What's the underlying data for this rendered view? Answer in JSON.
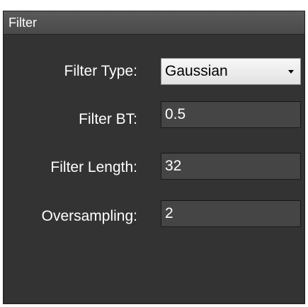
{
  "panel": {
    "title": "Filter"
  },
  "fields": [
    {
      "label": "Filter Type:",
      "value": "Gaussian",
      "kind": "select"
    },
    {
      "label": "Filter BT:",
      "value": "0.5",
      "kind": "text"
    },
    {
      "label": "Filter Length:",
      "value": "32",
      "kind": "text"
    },
    {
      "label": "Oversampling:",
      "value": "2",
      "kind": "text"
    }
  ],
  "icons": {
    "dropdown": "chevron-down-icon"
  },
  "colors": {
    "panel_background": "#333333",
    "header_background": "#4f4f4f",
    "field_background": "#454545",
    "text": "#ffffff"
  }
}
